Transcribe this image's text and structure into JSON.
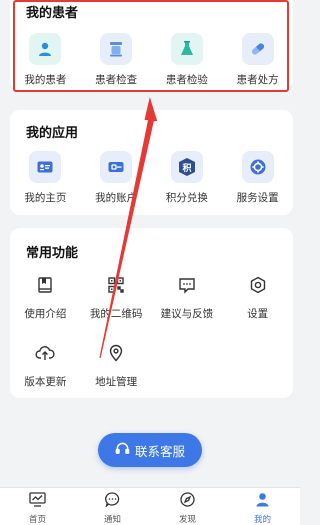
{
  "patients": {
    "title": "我的患者",
    "items": [
      {
        "label": "我的患者",
        "icon": "person-icon"
      },
      {
        "label": "患者检查",
        "icon": "checkup-icon"
      },
      {
        "label": "患者检验",
        "icon": "flask-icon"
      },
      {
        "label": "患者处方",
        "icon": "pill-icon"
      }
    ]
  },
  "apps": {
    "title": "我的应用",
    "items": [
      {
        "label": "我的主页",
        "icon": "id-card-icon"
      },
      {
        "label": "我的账户",
        "icon": "wallet-icon"
      },
      {
        "label": "积分兑换",
        "icon": "points-icon",
        "glyph": "积"
      },
      {
        "label": "服务设置",
        "icon": "settings-icon"
      }
    ]
  },
  "common": {
    "title": "常用功能",
    "items": [
      {
        "label": "使用介绍",
        "icon": "book-icon"
      },
      {
        "label": "我的二维码",
        "icon": "qr-code-icon"
      },
      {
        "label": "建议与反馈",
        "icon": "feedback-icon"
      },
      {
        "label": "设置",
        "icon": "hexagon-settings-icon"
      },
      {
        "label": "版本更新",
        "icon": "cloud-upload-icon"
      },
      {
        "label": "地址管理",
        "icon": "location-pin-icon"
      }
    ]
  },
  "service_button": {
    "label": "联系客服",
    "icon": "headset-icon"
  },
  "tabbar": [
    {
      "label": "首页",
      "icon": "monitor-icon",
      "active": false
    },
    {
      "label": "通知",
      "icon": "chat-bubble-icon",
      "active": false
    },
    {
      "label": "发现",
      "icon": "compass-icon",
      "active": false
    },
    {
      "label": "我的",
      "icon": "user-icon",
      "active": true
    }
  ],
  "colors": {
    "accent": "#3d78e6",
    "annotation": "#e53935",
    "mint_tile": "#e3f5f3",
    "soft_tile": "#e8eef9"
  }
}
